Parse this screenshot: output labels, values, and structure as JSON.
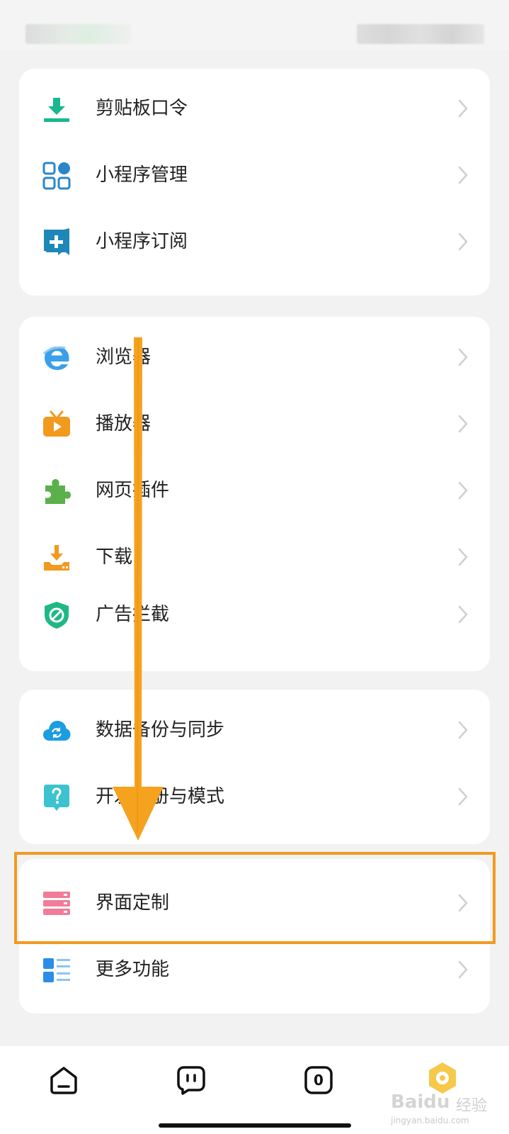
{
  "sections": [
    {
      "items": [
        {
          "label": "剪贴板口令",
          "icon": "clipboard-download-icon"
        },
        {
          "label": "小程序管理",
          "icon": "mini-program-grid-icon"
        },
        {
          "label": "小程序订阅",
          "icon": "subscription-bookmark-icon"
        }
      ]
    },
    {
      "items": [
        {
          "label": "浏览器",
          "icon": "browser-e-icon"
        },
        {
          "label": "播放器",
          "icon": "tv-play-icon"
        },
        {
          "label": "网页插件",
          "icon": "puzzle-icon"
        },
        {
          "label": "下载",
          "icon": "download-tray-icon"
        },
        {
          "label": "广告拦截",
          "icon": "shield-block-icon"
        }
      ]
    },
    {
      "items": [
        {
          "label": "数据备份与同步",
          "icon": "cloud-sync-icon"
        },
        {
          "label": "开发手册与模式",
          "icon": "help-bubble-icon"
        }
      ]
    },
    {
      "items": [
        {
          "label": "界面定制",
          "icon": "interface-customize-icon"
        },
        {
          "label": "更多功能",
          "icon": "more-list-icon"
        }
      ]
    }
  ],
  "tabbar": {
    "tabs": [
      {
        "icon": "home-icon"
      },
      {
        "icon": "face-icon"
      },
      {
        "icon": "tab-counter-icon",
        "count": "0"
      },
      {
        "icon": "profile-avatar-icon"
      }
    ]
  },
  "watermark": {
    "brand": "Baidu",
    "brand_cn": "经验",
    "url": "jingyan.baidu.com"
  },
  "colors": {
    "highlight": "#f19a20",
    "arrow": "#f5a21f",
    "background": "#f2f2f2"
  }
}
